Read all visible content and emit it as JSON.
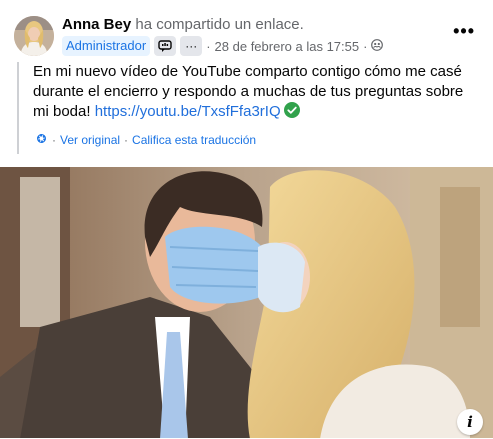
{
  "post": {
    "author": "Anna Bey",
    "action": " ha compartido un enlace.",
    "role": "Administrador",
    "separator": "·",
    "more_dots": "···",
    "date": "28 de febrero a las 17:55",
    "separator2": "·",
    "privacy_icon": "group-icon",
    "text_before_link": "En mi nuevo vídeo de YouTube comparto contigo cómo me casé durante el encierro y respondo a muchas de tus preguntas sobre mi boda! ",
    "link": "https://youtu.be/TxsfFfa3rIQ",
    "verified_icon": "check-circle-icon",
    "see_original": "Ver original",
    "translation_sep": "·",
    "rate_translation": "Califica esta traducción",
    "info_label": "i"
  },
  "colors": {
    "link": "#216fdb",
    "badge_bg": "#e7f3ff",
    "badge_text": "#1b74e4",
    "verified": "#31a24c"
  }
}
